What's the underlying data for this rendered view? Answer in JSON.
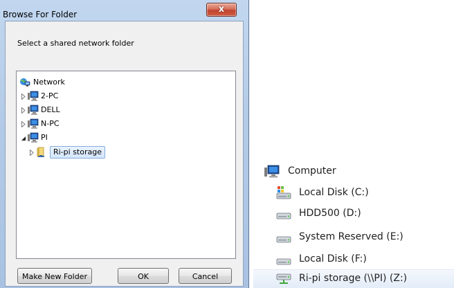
{
  "dialog": {
    "title": "Browse For Folder",
    "close_glyph": "x",
    "instruction": "Select a shared network folder",
    "tree": [
      {
        "label": "Network",
        "icon": "network-icon",
        "expanded": true
      },
      {
        "label": "2-PC",
        "icon": "computer-icon",
        "expanded": false
      },
      {
        "label": "DELL",
        "icon": "computer-icon",
        "expanded": false
      },
      {
        "label": "N-PC",
        "icon": "computer-icon",
        "expanded": false
      },
      {
        "label": "PI",
        "icon": "computer-icon",
        "expanded": true
      },
      {
        "label": "Ri-pi storage",
        "icon": "shared-folder-icon",
        "expanded": false,
        "selected": true
      }
    ],
    "buttons": {
      "make_new_folder": "Make New Folder",
      "ok": "OK",
      "cancel": "Cancel"
    }
  },
  "explorer": {
    "computer_label": "Computer",
    "drives": [
      {
        "label": "Local Disk (C:)",
        "icon": "system-drive-icon"
      },
      {
        "label": "HDD500 (D:)",
        "icon": "hard-drive-icon"
      },
      {
        "label": "System Reserved (E:)",
        "icon": "hard-drive-icon"
      },
      {
        "label": "Local Disk (F:)",
        "icon": "hard-drive-icon"
      },
      {
        "label": "Ri-pi storage (\\\\PI) (Z:)",
        "icon": "network-drive-icon"
      }
    ]
  },
  "colors": {
    "title_gradient": "#b4cbe7",
    "selection_border": "#84acdd",
    "selection_fill": "#d3e6fb",
    "close_red": "#c14530"
  }
}
